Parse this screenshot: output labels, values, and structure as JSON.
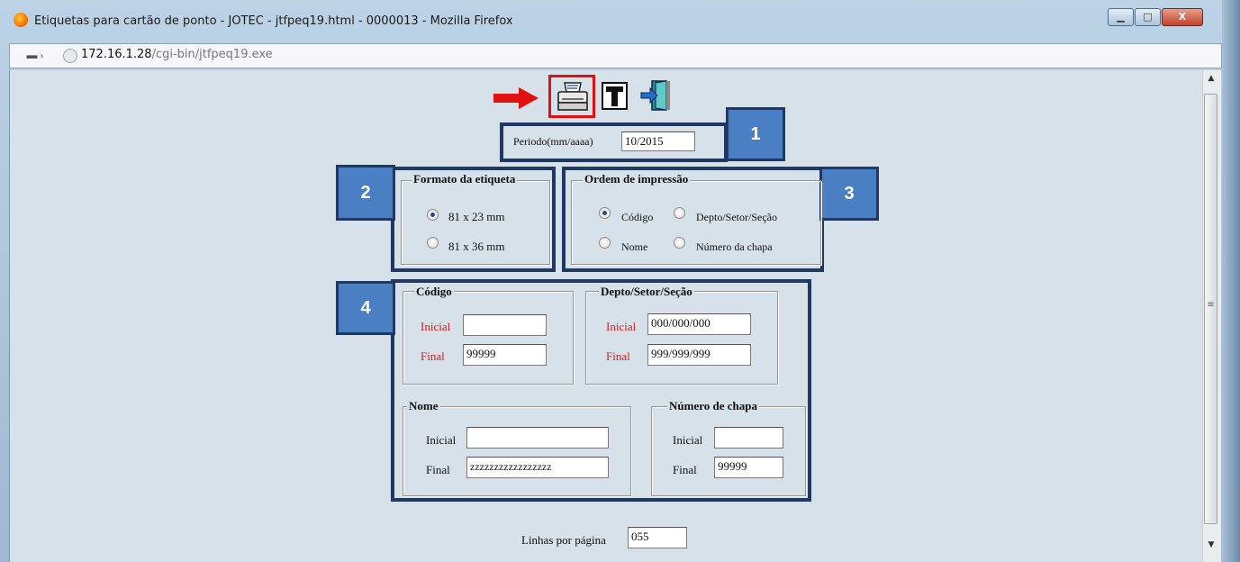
{
  "window": {
    "title": "Etiquetas para cartão de ponto - JOTEC - jtfpeq19.html - 0000013 - Mozilla Firefox",
    "min_glyph": "▁",
    "max_glyph": "□",
    "close_glyph": "X"
  },
  "address_bar": {
    "host": "172.16.1.28",
    "path": "/cgi-bin/jtfpeq19.exe"
  },
  "toolbar": {
    "icons": [
      "print-icon",
      "text-icon",
      "exit-icon"
    ],
    "highlight_color": "#e01010"
  },
  "periodo": {
    "label": "Periodo(mm/aaaa)",
    "value": "10/2015"
  },
  "formato": {
    "legend": "Formato da etiqueta",
    "options": [
      {
        "label": "81 x 23 mm",
        "checked": true
      },
      {
        "label": "81 x 36 mm",
        "checked": false
      }
    ]
  },
  "ordem": {
    "legend": "Ordem de impressão",
    "options": [
      {
        "label": "Código",
        "checked": true
      },
      {
        "label": "Depto/Setor/Seção",
        "checked": false
      },
      {
        "label": "Nome",
        "checked": false
      },
      {
        "label": "Número da chapa",
        "checked": false
      }
    ]
  },
  "codigo": {
    "legend": "Código",
    "inicial_label": "Inicial",
    "inicial": "",
    "final_label": "Final",
    "final": "99999"
  },
  "depto": {
    "legend": "Depto/Setor/Seção",
    "inicial_label": "Inicial",
    "inicial": "000/000/000",
    "final_label": "Final",
    "final": "999/999/999"
  },
  "nome": {
    "legend": "Nome",
    "inicial_label": "Inicial",
    "inicial": "",
    "final_label": "Final",
    "final": "zzzzzzzzzzzzzzzzz"
  },
  "chapa": {
    "legend": "Número de chapa",
    "inicial_label": "Inicial",
    "inicial": "",
    "final_label": "Final",
    "final": "99999"
  },
  "linhas": {
    "label": "Linhas por página",
    "value": "055"
  },
  "badges": [
    "1",
    "2",
    "3",
    "4"
  ],
  "colors": {
    "annotation_navy": "#1f3864",
    "badge_blue": "#4a7fc4",
    "required_label": "#d61a1a"
  }
}
